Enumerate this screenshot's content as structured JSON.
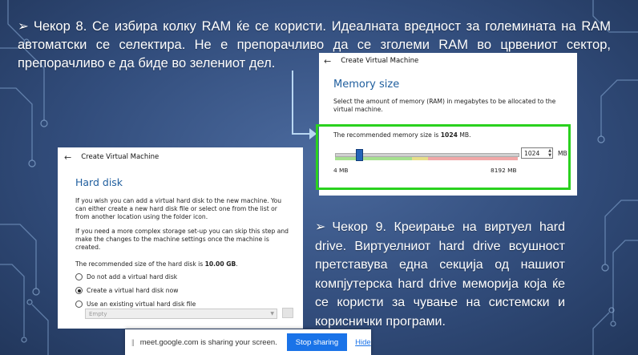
{
  "slide": {
    "step8": {
      "bullet": "➢",
      "text": "Чекор 8. Се избира колку RAM ќе се користи. Идеалната вредност за големината на RAM автоматски се селектира. Не е препорачливо да се зголеми RAM во црвениот сектор, препорачливо е да биде во зелениот дел."
    },
    "step9": {
      "bullet": "➢",
      "text": "Чекор 9. Креирање на виртуел hard drive. Виртуелниот hard drive всушност претставува една секција од нашиот компјутерска hard drive меморија која ќе се користи за чување на системски и кориснички програми."
    }
  },
  "memory_dialog": {
    "window_title": "Create Virtual Machine",
    "back_icon": "←",
    "title": "Memory size",
    "description": "Select the amount of memory (RAM) in megabytes to be allocated to the virtual machine.",
    "recommended_prefix": "The recommended memory size is ",
    "recommended_value": "1024",
    "recommended_suffix": " MB.",
    "slider_min": "4 MB",
    "slider_max": "8192 MB",
    "slider_value_fraction": 0.125,
    "spin_value": "1024",
    "unit": "MB",
    "highlight_color": "#2ad11e"
  },
  "hd_dialog": {
    "window_title": "Create Virtual Machine",
    "back_icon": "←",
    "title": "Hard disk",
    "para1": "If you wish you can add a virtual hard disk to the new machine. You can either create a new hard disk file or select one from the list or from another location using the folder icon.",
    "para2": "If you need a more complex storage set-up you can skip this step and make the changes to the machine settings once the machine is created.",
    "recommended_prefix": "The recommended size of the hard disk is ",
    "recommended_value": "10.00 GB",
    "recommended_suffix": ".",
    "options": [
      {
        "label": "Do not add a virtual hard disk",
        "checked": false
      },
      {
        "label": "Create a virtual hard disk now",
        "checked": true
      },
      {
        "label": "Use an existing virtual hard disk file",
        "checked": false
      }
    ],
    "select_placeholder": "Empty"
  },
  "share_bar": {
    "grip": "||",
    "message": "meet.google.com is sharing your screen.",
    "stop_label": "Stop sharing",
    "hide_label": "Hide",
    "accent": "#1a73e8"
  }
}
